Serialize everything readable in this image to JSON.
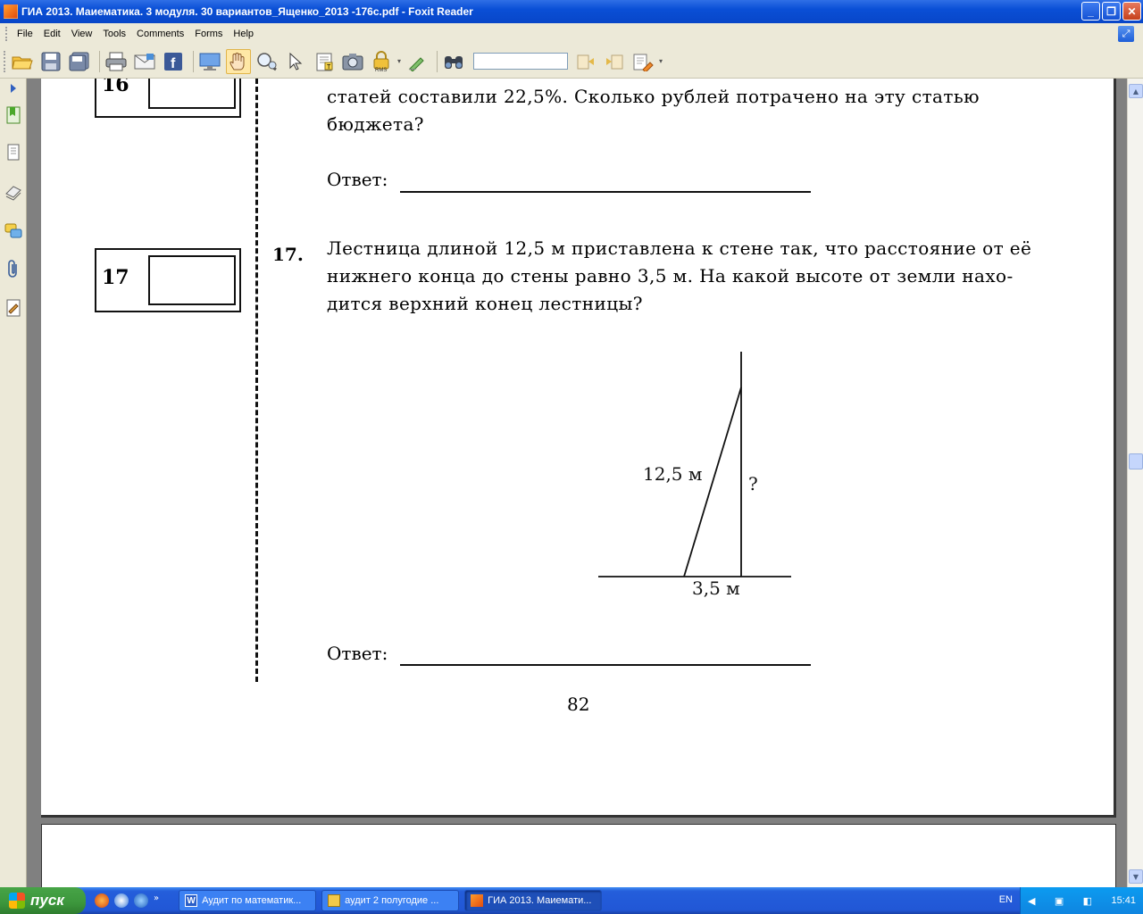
{
  "window": {
    "title": "ГИА 2013. Маиематика. 3 модуля. 30 вариантов_Ященко_2013 -176с.pdf - Foxit Reader",
    "buttons": [
      "_",
      "❐",
      "✕"
    ]
  },
  "menu": [
    "File",
    "Edit",
    "View",
    "Tools",
    "Comments",
    "Forms",
    "Help"
  ],
  "toolbar": {
    "icons": [
      "open-icon",
      "save-icon",
      "save-all-icon",
      "print-icon",
      "email-icon",
      "facebook-icon",
      "fullscreen-icon",
      "hand-tool-icon",
      "zoom-tool-icon",
      "select-tool-icon",
      "text-select-icon",
      "snapshot-icon",
      "rms-icon",
      "sign-icon",
      "find-binoculars-icon",
      "find-prev-icon",
      "find-next-icon",
      "highlight-icon"
    ],
    "find_value": ""
  },
  "document": {
    "box16": "16",
    "box17": "17",
    "q16_text_line1": "статей составили 22,5%. Сколько рублей потрачено на эту статью",
    "q16_text_line2": "бюджета?",
    "answer_label": "Ответ:",
    "q17_number": "17.",
    "q17_line1": "Лестница длиной 12,5 м приставлена к стене так, что расстояние от её",
    "q17_line2": "нижнего конца до стены равно 3,5 м. На какой высоте от земли нахо-",
    "q17_line3": "дится верхний конец лестницы?",
    "figure": {
      "ladder_label": "12,5 м",
      "height_label": "?",
      "base_label": "3,5 м"
    },
    "page_number": "82"
  },
  "taskbar": {
    "start_label": "пуск",
    "tasks": [
      {
        "label": "Аудит по математик...",
        "icon": "word-icon",
        "active": false
      },
      {
        "label": "аудит 2 полугодие ...",
        "icon": "folder-icon",
        "active": false
      },
      {
        "label": "ГИА 2013. Маиемати...",
        "icon": "foxit-icon",
        "active": true
      }
    ],
    "language": "EN",
    "clock": "15:41"
  }
}
